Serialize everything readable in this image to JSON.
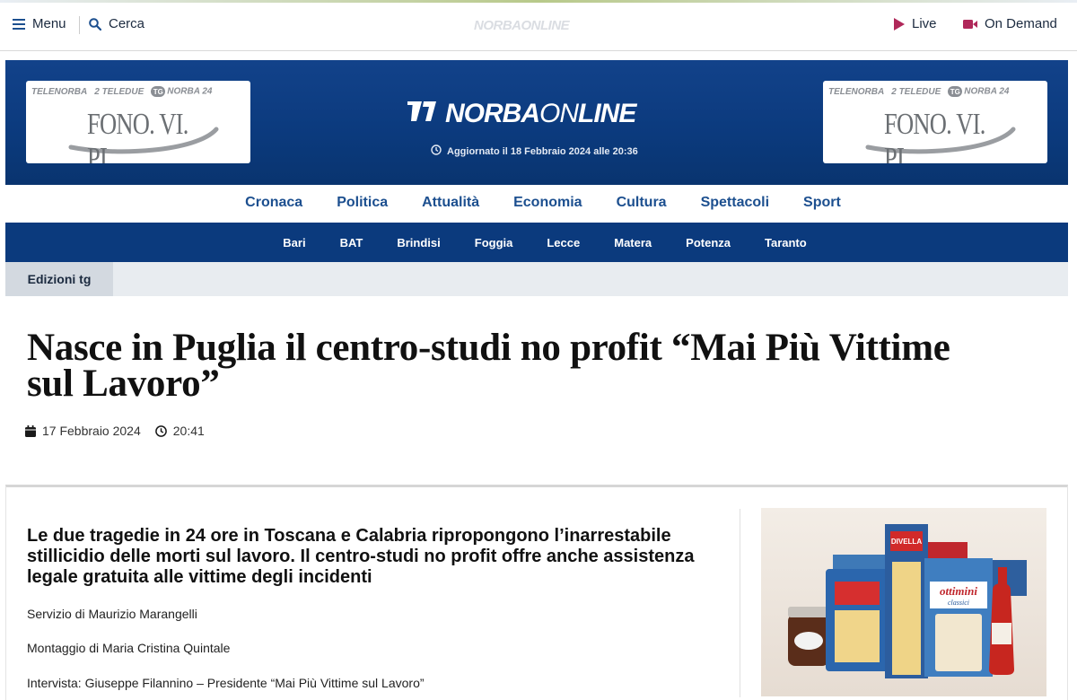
{
  "topbar": {
    "menu_label": "Menu",
    "search_label": "Cerca",
    "faint_logo": "NORBAONLINE",
    "live_label": "Live",
    "ondemand_label": "On Demand"
  },
  "header": {
    "logo_bold": "NORBA",
    "logo_thin": "ON",
    "logo_end": "LINE",
    "updated": "Aggiornato il 18 Febbraio 2024 alle 20:36",
    "ad": {
      "brand1": "TELENORBA",
      "brand2": "2 TELEDUE",
      "brand3": "NORBA 24",
      "brand3_badge": "TG",
      "text": "FONO. VI. PI."
    }
  },
  "categories": [
    "Cronaca",
    "Politica",
    "Attualità",
    "Economia",
    "Cultura",
    "Spettacoli",
    "Sport"
  ],
  "provinces": [
    "Bari",
    "BAT",
    "Brindisi",
    "Foggia",
    "Lecce",
    "Matera",
    "Potenza",
    "Taranto"
  ],
  "editions_tab": "Edizioni tg",
  "article": {
    "title": "Nasce in Puglia il centro-studi no profit “Mai Più Vittime sul Lavoro”",
    "date": "17 Febbraio 2024",
    "time": "20:41",
    "subtitle": "Le due tragedie in 24 ore in Toscana e Calabria ripropongono l’inarrestabile stillicidio delle morti sul lavoro. Il centro-studi no profit offre anche assistenza legale gratuita alle vittime degli incidenti",
    "credits": [
      "Servizio di Maurizio Marangelli",
      "Montaggio di Maria Cristina Quintale",
      "Intervista: Giuseppe Filannino – Presidente “Mai Più Vittime sul Lavoro”"
    ]
  },
  "promo": {
    "brand": "DIVELLA",
    "product": "ottimini",
    "product_sub": "classici"
  },
  "colors": {
    "header_blue": "#12428a",
    "nav_blue": "#0b3a7d",
    "link_blue": "#1c4f8f",
    "live_accent": "#b0285a"
  },
  "icons": {
    "menu": "hamburger-icon",
    "search": "search-icon",
    "live": "play-icon",
    "ondemand": "video-camera-icon",
    "updated": "clock-icon",
    "date": "calendar-icon",
    "time": "clock-icon"
  }
}
